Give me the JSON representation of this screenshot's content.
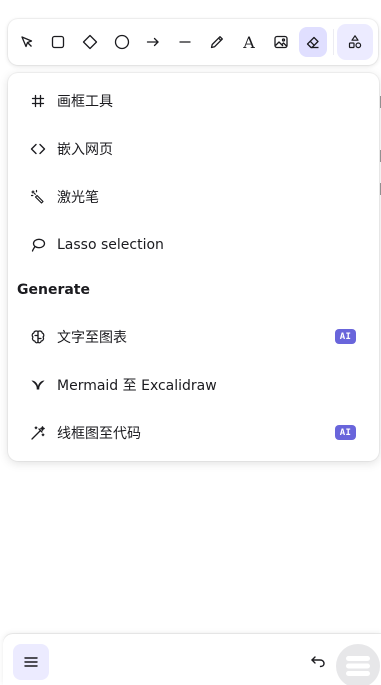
{
  "toolbar": {
    "tools": [
      {
        "name": "selection-tool",
        "icon": "pointer-arrow-icon",
        "active": false
      },
      {
        "name": "rectangle-tool",
        "icon": "square-icon",
        "active": false
      },
      {
        "name": "diamond-tool",
        "icon": "diamond-icon",
        "active": false
      },
      {
        "name": "ellipse-tool",
        "icon": "circle-icon",
        "active": false
      },
      {
        "name": "arrow-tool",
        "icon": "arrow-right-icon",
        "active": false
      },
      {
        "name": "line-tool",
        "icon": "line-icon",
        "active": false
      },
      {
        "name": "draw-tool",
        "icon": "pencil-icon",
        "active": false
      },
      {
        "name": "text-tool",
        "icon": "text-a-icon",
        "label": "A",
        "active": false
      },
      {
        "name": "image-tool",
        "icon": "image-icon",
        "active": false
      },
      {
        "name": "eraser-tool",
        "icon": "eraser-icon",
        "active": true
      }
    ],
    "extra_tools": {
      "icon": "shapes-icon"
    }
  },
  "menu": {
    "items": [
      {
        "label": "画框工具",
        "icon": "frame-hash-icon"
      },
      {
        "label": "嵌入网页",
        "icon": "embed-code-icon"
      },
      {
        "label": "激光笔",
        "icon": "laser-pointer-icon"
      },
      {
        "label": "Lasso selection",
        "icon": "lasso-icon"
      }
    ],
    "generate_heading": "Generate",
    "generate_items": [
      {
        "label": "文字至图表",
        "icon": "brain-icon",
        "badge": "AI"
      },
      {
        "label": "Mermaid 至 Excalidraw",
        "icon": "mermaid-icon"
      },
      {
        "label": "线框图至代码",
        "icon": "magic-wand-icon",
        "badge": "AI"
      }
    ]
  },
  "footer": {
    "menu_icon": "hamburger-icon",
    "undo_icon": "undo-icon",
    "fab_icon": "hamburger-icon"
  },
  "colors": {
    "accent": "#6965db",
    "active_bg": "#e0dfff",
    "soft_bg": "#ecebff",
    "text": "#1b1b1f"
  }
}
